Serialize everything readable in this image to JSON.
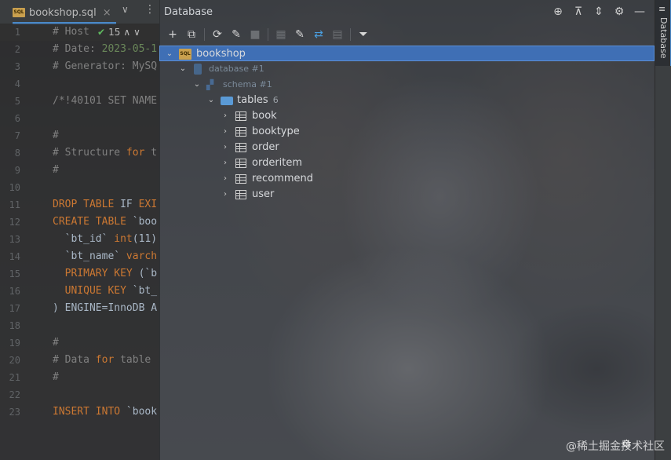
{
  "editor": {
    "tab_label": "bookshop.sql",
    "tab_close": "×",
    "tab_more": "∨",
    "tab_menu": "⋮",
    "sql_badge": "SQL",
    "inspection": {
      "check": "✔",
      "count": "15",
      "up": "∧",
      "down": "∨"
    },
    "lines": [
      {
        "n": "1",
        "parts": [
          {
            "cls": "c",
            "t": "# Host"
          }
        ]
      },
      {
        "n": "2",
        "parts": [
          {
            "cls": "c",
            "t": "# Date: "
          },
          {
            "cls": "s",
            "t": "2023-05-1"
          }
        ]
      },
      {
        "n": "3",
        "parts": [
          {
            "cls": "c",
            "t": "# Generator: MySQ"
          }
        ]
      },
      {
        "n": "4",
        "parts": []
      },
      {
        "n": "5",
        "parts": [
          {
            "cls": "c",
            "t": "/*!40101 SET NAME"
          }
        ]
      },
      {
        "n": "6",
        "parts": []
      },
      {
        "n": "7",
        "parts": [
          {
            "cls": "c",
            "t": "#"
          }
        ]
      },
      {
        "n": "8",
        "parts": [
          {
            "cls": "c",
            "t": "# Structure "
          },
          {
            "cls": "k",
            "t": "for"
          },
          {
            "cls": "c",
            "t": " t"
          }
        ]
      },
      {
        "n": "9",
        "parts": [
          {
            "cls": "c",
            "t": "#"
          }
        ]
      },
      {
        "n": "10",
        "parts": []
      },
      {
        "n": "11",
        "parts": [
          {
            "cls": "k",
            "t": "DROP TABLE"
          },
          {
            "cls": "t",
            "t": " IF "
          },
          {
            "cls": "k",
            "t": "EXI"
          }
        ]
      },
      {
        "n": "12",
        "parts": [
          {
            "cls": "k",
            "t": "CREATE TABLE"
          },
          {
            "cls": "t",
            "t": " `boo"
          }
        ]
      },
      {
        "n": "13",
        "parts": [
          {
            "cls": "t",
            "t": "  `bt_id` "
          },
          {
            "cls": "k",
            "t": "int"
          },
          {
            "cls": "t",
            "t": "(11)"
          }
        ]
      },
      {
        "n": "14",
        "parts": [
          {
            "cls": "t",
            "t": "  `bt_name` "
          },
          {
            "cls": "k",
            "t": "varch"
          }
        ]
      },
      {
        "n": "15",
        "parts": [
          {
            "cls": "k",
            "t": "  PRIMARY KEY"
          },
          {
            "cls": "t",
            "t": " (`b"
          }
        ]
      },
      {
        "n": "16",
        "parts": [
          {
            "cls": "k",
            "t": "  UNIQUE KEY"
          },
          {
            "cls": "t",
            "t": " `bt_"
          }
        ]
      },
      {
        "n": "17",
        "parts": [
          {
            "cls": "t",
            "t": ") ENGINE=InnoDB A"
          }
        ]
      },
      {
        "n": "18",
        "parts": []
      },
      {
        "n": "19",
        "parts": [
          {
            "cls": "c",
            "t": "#"
          }
        ]
      },
      {
        "n": "20",
        "parts": [
          {
            "cls": "c",
            "t": "# Data "
          },
          {
            "cls": "k",
            "t": "for"
          },
          {
            "cls": "c",
            "t": " table"
          }
        ]
      },
      {
        "n": "21",
        "parts": [
          {
            "cls": "c",
            "t": "#"
          }
        ]
      },
      {
        "n": "22",
        "parts": []
      },
      {
        "n": "23",
        "parts": [
          {
            "cls": "k",
            "t": "INSERT INTO"
          },
          {
            "cls": "t",
            "t": " `book"
          }
        ]
      }
    ]
  },
  "database": {
    "title": "Database",
    "header_icons": [
      "target-icon",
      "collapse-all-icon",
      "expand-icon",
      "gear-icon",
      "minimize-icon"
    ],
    "header_glyphs": [
      "⊕",
      "⊼",
      "⇕",
      "⚙",
      "—"
    ],
    "toolbar_glyphs": [
      "+",
      "⧉",
      "⟳",
      "✎",
      "■",
      "▦",
      "✎",
      "⇄",
      "▤",
      "⏷"
    ],
    "tree": {
      "root": {
        "label": "bookshop",
        "badge": "SQL"
      },
      "database": {
        "label": "database #1"
      },
      "schema": {
        "label": "schema #1"
      },
      "tables_folder": {
        "label": "tables",
        "count": "6"
      },
      "tables": [
        "book",
        "booktype",
        "order",
        "orderitem",
        "recommend",
        "user"
      ]
    },
    "arrow_expanded": "⌄",
    "arrow_collapsed": "›"
  },
  "side_strip": {
    "label": "Database",
    "icon": "≡"
  },
  "watermark": "@稀土掘金技术社区",
  "status_gear": "⚙"
}
